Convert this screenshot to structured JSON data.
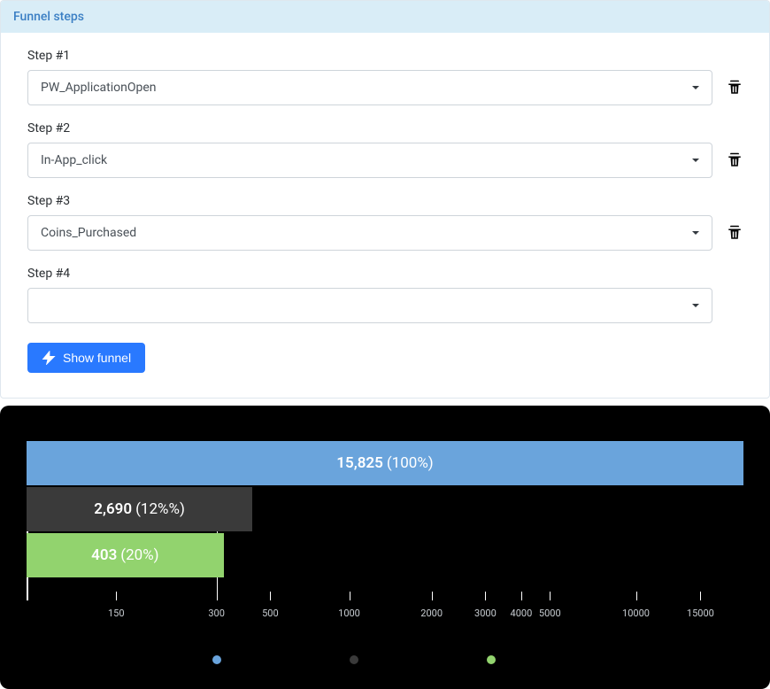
{
  "panel": {
    "title": "Funnel steps"
  },
  "steps": [
    {
      "label": "Step #1",
      "value": "PW_ApplicationOpen"
    },
    {
      "label": "Step #2",
      "value": "In-App_click"
    },
    {
      "label": "Step #3",
      "value": "Coins_Purchased"
    },
    {
      "label": "Step #4",
      "value": ""
    }
  ],
  "button": {
    "label": "Show funnel"
  },
  "chart_data": {
    "type": "bar",
    "orientation": "horizontal",
    "x_scale": "log",
    "xlim": [
      0,
      15000
    ],
    "ticks": [
      150,
      300,
      500,
      1000,
      2000,
      3000,
      4000,
      5000,
      10000,
      15000
    ],
    "series": [
      {
        "value": 15825,
        "pct": "100%",
        "color": "blue"
      },
      {
        "value": 2690,
        "pct": "12%%",
        "color": "dark"
      },
      {
        "value": 403,
        "pct": "20%",
        "color": "green"
      }
    ],
    "legend": [
      "blue",
      "dark",
      "green"
    ]
  },
  "display": {
    "bar0_value": "15,825",
    "bar0_pct": "(100%)",
    "bar1_value": "2,690",
    "bar1_pct": "(12%%)",
    "bar2_value": "403",
    "bar2_pct": "(20%)",
    "tick_150": "150",
    "tick_300": "300",
    "tick_500": "500",
    "tick_1000": "1000",
    "tick_2000": "2000",
    "tick_3000": "3000",
    "tick_4000": "4000",
    "tick_5000": "5000",
    "tick_10000": "10000",
    "tick_15000": "15000"
  }
}
